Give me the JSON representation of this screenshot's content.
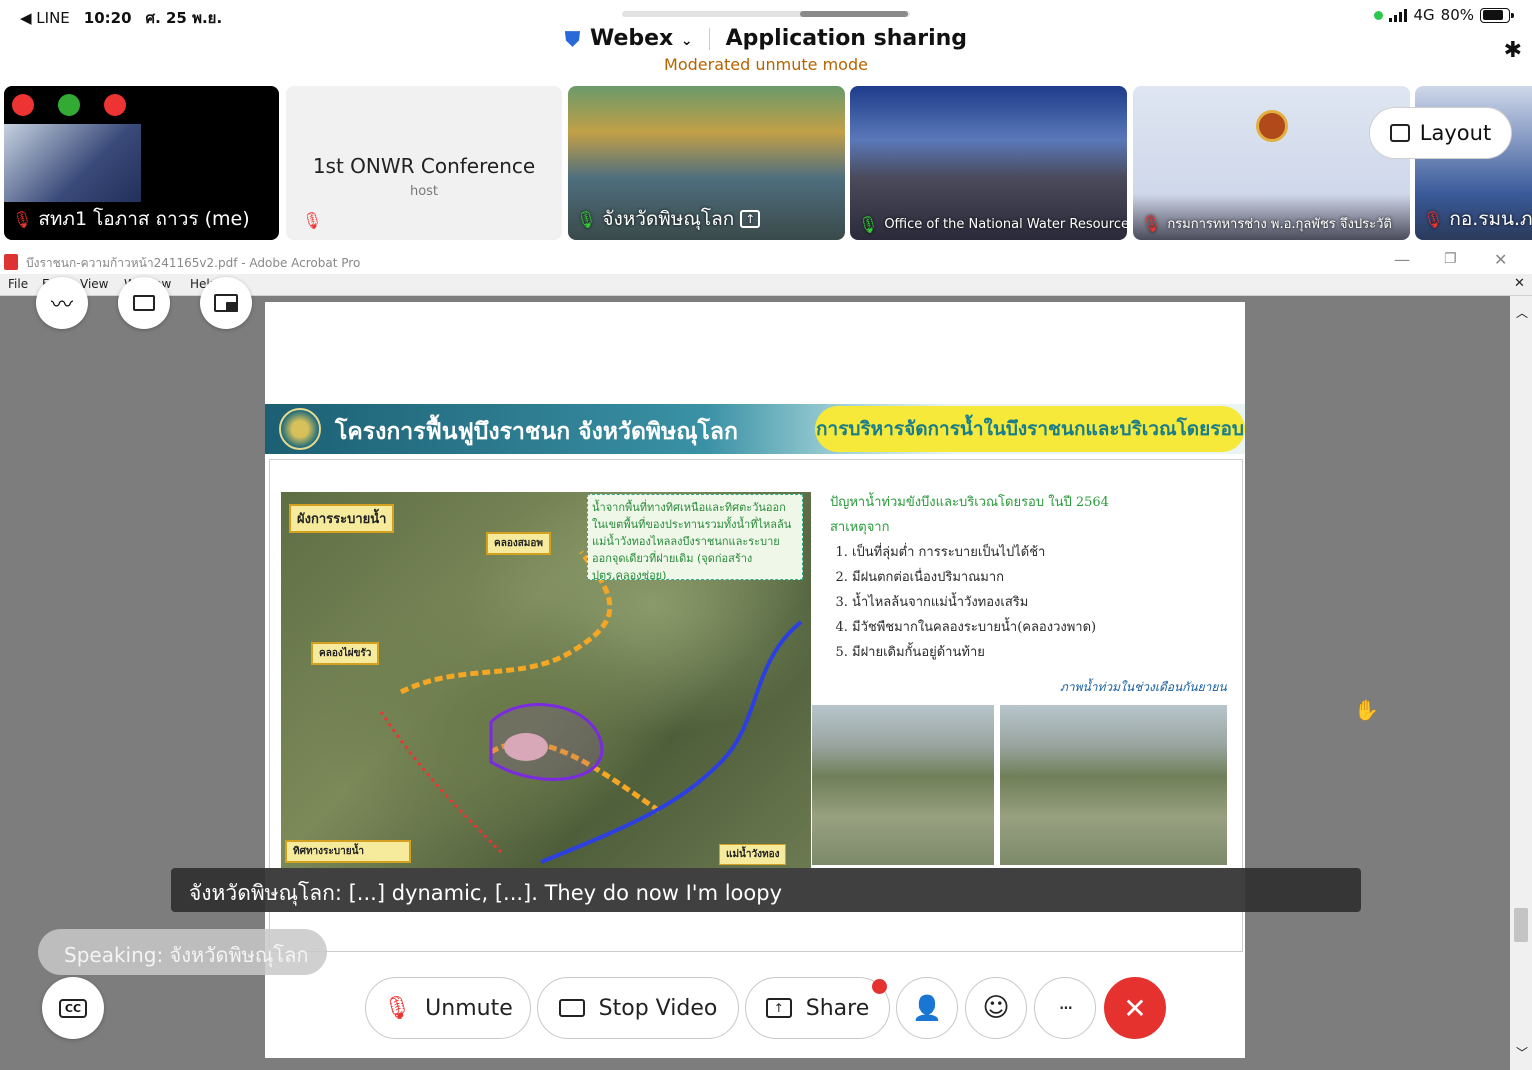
{
  "status_bar": {
    "back_app": "◀ LINE",
    "time": "10:20",
    "date": "ศ. 25 พ.ย.",
    "network": "4G",
    "battery": "80%",
    "battery_level": 0.8
  },
  "meeting": {
    "app_name": "Webex",
    "title": "Application sharing",
    "subtitle": "Moderated unmute mode"
  },
  "participants": [
    {
      "name": "สทภ1 โอภาส ถาวร (me)",
      "muted": true
    },
    {
      "name": "1st ONWR Conference",
      "role": "host",
      "muted": true
    },
    {
      "name": "จังหวัดพิษณุโลก",
      "muted": false
    },
    {
      "name": "Office of the National Water Resources",
      "muted": false
    },
    {
      "name": "กรมการทหารช่าง พ.อ.กุลพัชร จึงประวัติ",
      "muted": true
    },
    {
      "name": "กอ.รมน.ภ",
      "muted": true
    }
  ],
  "layout_button": "Layout",
  "acrobat": {
    "window_title": "บึงราชนก-ความก้าวหน้า241165v2.pdf - Adobe Acrobat Pro",
    "menu": [
      "File",
      "Edit",
      "View",
      "Window",
      "Help"
    ]
  },
  "slide": {
    "title": "โครงการฟื้นฟูบึงราชนก จังหวัดพิษณุโลก",
    "banner_right": "การบริหารจัดการน้ำในบึงราชนกและบริเวณโดยรอบ",
    "map_labels": {
      "drainage_plan": "ผังการระบายน้ำ",
      "canal_top": "คลองสมอพ",
      "canal_left": "คลองไผ่ขรัว",
      "river": "แม่น้ำวังทอง",
      "legend": "ทิศทางระบายน้ำ"
    },
    "map_note": "น้ำจากพื้นที่ทางทิศเหนือและทิศตะวันออกในเขตพื้นที่ของประทานรวมทั้งน้ำที่ไหลล้นแม่น้ำวังทองไหลลงบึงราชนกและระบายออกจุดเดียวที่ฝายเดิม (จุดก่อสร้าง ปตร.คลองช่อย)",
    "problem_heading": "ปัญหาน้ำท่วมขังบึงและบริเวณโดยรอบ ในปี 2564",
    "cause_heading": "สาเหตุจาก",
    "causes": [
      "เป็นที่ลุ่มต่ำ การระบายเป็นไปได้ช้า",
      "มีฝนตกต่อเนื่องปริมาณมาก",
      "น้ำไหลล้นจากแม่น้ำวังทองเสริม",
      "มีวัชพืชมากในคลองระบายน้ำ(คลองวงพาด)",
      "มีฝายเดิมกั้นอยู่ด้านท้าย"
    ],
    "photo_caption": "ภาพน้ำท่วมในช่วงเดือนกันยายน"
  },
  "caption_text": "จังหวัดพิษณุโลก: [...] dynamic, [...]. They do now I'm loopy",
  "speaking_text": "Speaking: จังหวัดพิษณุโลก",
  "controls": {
    "unmute": "Unmute",
    "stop_video": "Stop Video",
    "share": "Share",
    "more": "···"
  },
  "colors": {
    "leave": "#e5322f",
    "subtitle": "#b56400",
    "banner_yellow": "#f7e93a"
  }
}
